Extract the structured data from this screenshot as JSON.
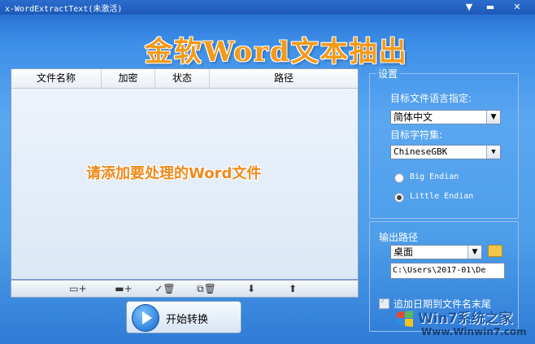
{
  "window": {
    "title": "x-WordExtractText(未激活)"
  },
  "banner": {
    "title": "金软Word文本抽出"
  },
  "filelist": {
    "columns": [
      "文件名称",
      "加密",
      "状态",
      "路径"
    ],
    "hint": "请添加要处理的Word文件"
  },
  "toolbar": {
    "add_file": "▭+",
    "add_folder": "▬+",
    "remove_checked": "✓🗑",
    "remove_all": "⧉🗑",
    "move_down": "⬇",
    "move_up": "⬆"
  },
  "start_button": {
    "label": "开始转换"
  },
  "settings": {
    "group_title": "设置",
    "target_lang_label": "目标文件语言指定:",
    "target_lang_value": "简体中文",
    "charset_label": "目标字符集:",
    "charset_value": "ChineseGBK",
    "big_endian": "Big Endian",
    "little_endian": "Little Endian"
  },
  "output": {
    "label": "输出路径",
    "dest_value": "桌面",
    "path_value": "C:\\Users\\2017-01\\De",
    "append_date": "追加日期到文件名末尾"
  },
  "watermark": {
    "brand": "Win7系统之家",
    "url": "Www.Winwin7.com"
  }
}
